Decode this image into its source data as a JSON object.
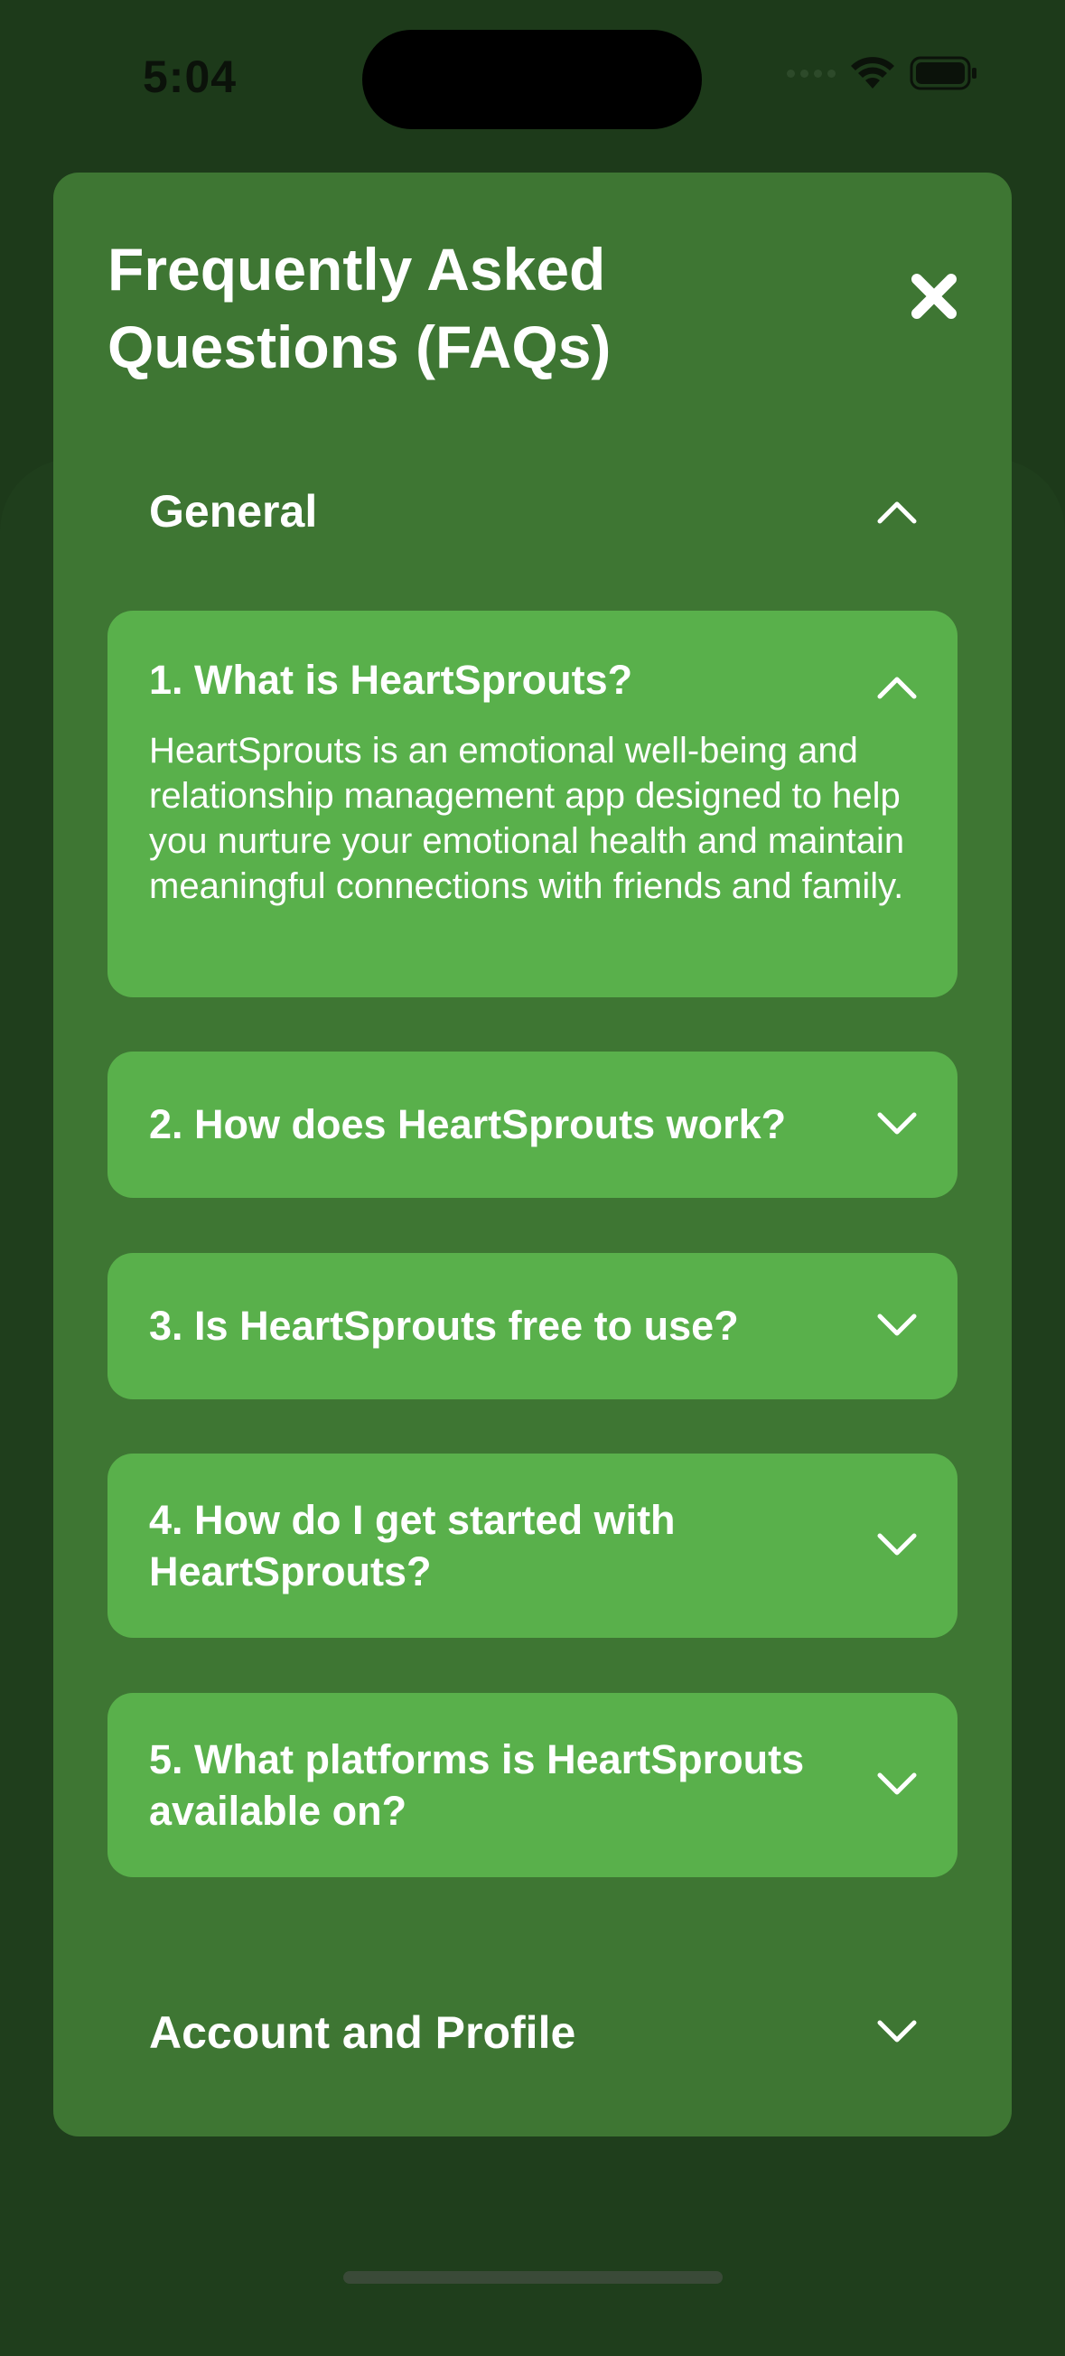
{
  "status_bar": {
    "time": "5:04"
  },
  "modal": {
    "title": "Frequently Asked Questions (FAQs)",
    "close_icon": "close-icon"
  },
  "sections": [
    {
      "title": "General",
      "expanded": true
    },
    {
      "title": "Account and Profile",
      "expanded": false
    }
  ],
  "faqs": [
    {
      "question": "1. What is HeartSprouts?",
      "answer": "HeartSprouts is an emotional well-being and relationship management app designed to help you nurture your emotional health and maintain meaningful connections with friends and family.",
      "expanded": true
    },
    {
      "question": "2. How does HeartSprouts work?",
      "expanded": false
    },
    {
      "question": "3. Is HeartSprouts free to use?",
      "expanded": false
    },
    {
      "question": "4. How do I get started with HeartSprouts?",
      "expanded": false
    },
    {
      "question": "5. What platforms is HeartSprouts available on?",
      "expanded": false
    }
  ],
  "colors": {
    "background": "#1d3a1a",
    "modal": "#3e7633",
    "card": "#59b04b",
    "text": "#ffffff"
  }
}
